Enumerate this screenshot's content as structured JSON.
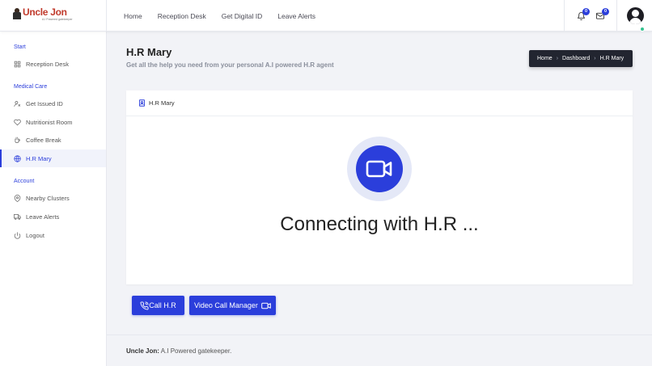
{
  "brand": {
    "name": "Uncle Jon",
    "tagline": "A.I Powered gatekeeper"
  },
  "topnav": {
    "items": [
      "Home",
      "Reception Desk",
      "Get Digital ID",
      "Leave Alerts"
    ]
  },
  "header_right": {
    "notifications_count": "0",
    "messages_count": "0"
  },
  "sidebar": {
    "sections": [
      {
        "heading": "Start",
        "items": [
          {
            "label": "Reception Desk",
            "icon": "grid-icon"
          }
        ]
      },
      {
        "heading": "Medical Care",
        "items": [
          {
            "label": "Get Issued ID",
            "icon": "id-icon"
          },
          {
            "label": "Nutritionist Room",
            "icon": "heart-icon"
          },
          {
            "label": "Coffee Break",
            "icon": "coffee-icon"
          },
          {
            "label": "H.R Mary",
            "icon": "globe-icon",
            "active": true
          }
        ]
      },
      {
        "heading": "Account",
        "items": [
          {
            "label": "Nearby Clusters",
            "icon": "map-pin-icon"
          },
          {
            "label": "Leave Alerts",
            "icon": "truck-icon"
          },
          {
            "label": "Logout",
            "icon": "power-icon"
          }
        ]
      }
    ]
  },
  "page": {
    "title": "H.R Mary",
    "subtitle": "Get all the help you need from your personal A.I powered H.R agent"
  },
  "breadcrumb": {
    "items": [
      "Home",
      "Dashboard",
      "H.R Mary"
    ]
  },
  "card": {
    "title": "H.R Mary",
    "status": "Connecting with H.R ..."
  },
  "actions": {
    "call_label": "Call H.R",
    "video_label": "Video Call Manager"
  },
  "footer": {
    "brand": "Uncle Jon:",
    "text": "A.I Powered gatekeeper."
  },
  "colors": {
    "accent": "#2b3edb",
    "sidebar_active_bg": "#f1f3fb",
    "breadcrumb_bg": "#222530",
    "video_ring": "#e4e8f7",
    "online": "#34c38f"
  }
}
